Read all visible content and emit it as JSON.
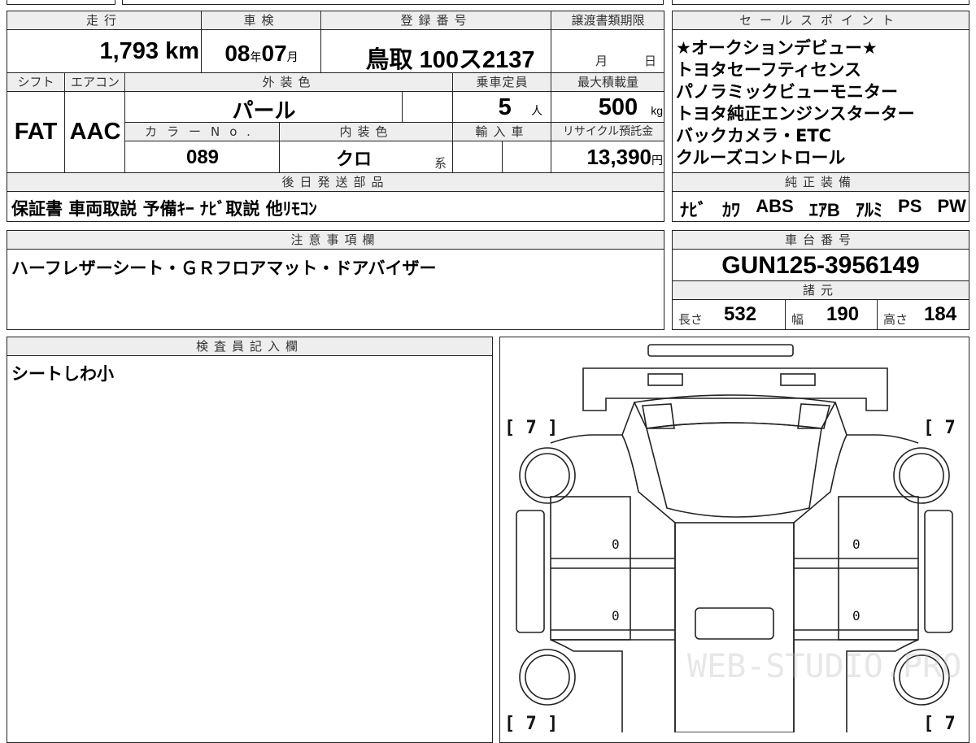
{
  "top_row": {
    "headers": {
      "mileage": "走行",
      "inspection": "車検",
      "registration": "登録番号",
      "transfer_deadline": "譲渡書類期限",
      "shift": "シフト",
      "aircon": "エアコン",
      "exterior_color": "外装色",
      "capacity": "乗車定員",
      "max_load": "最大積載量",
      "color_no": "カラーNo.",
      "interior_color": "内装色",
      "import": "輸入車",
      "recycle": "リサイクル預託金",
      "delivery_parts": "後日発送部品"
    },
    "mileage_value": "1,793",
    "mileage_unit": "km",
    "inspection_year": "08",
    "year_unit": "年",
    "inspection_month": "07",
    "month_unit": "月",
    "registration_value": "鳥取 100ス2137",
    "transfer_month_unit": "月",
    "transfer_day_unit": "日",
    "shift_value": "FAT",
    "aircon_value": "AAC",
    "exterior_color_value": "パール",
    "capacity_value": "5",
    "capacity_unit": "人",
    "max_load_value": "500",
    "max_load_unit": "kg",
    "color_no_value": "089",
    "interior_color_value": "クロ",
    "interior_suffix": "系",
    "recycle_value": "13,390",
    "recycle_unit": "円",
    "delivery_parts_value": "保証書 車両取説 予備ｷｰ ﾅﾋﾞ取説 他ﾘﾓｺﾝ"
  },
  "sales_points": {
    "header": "セールスポイント",
    "lines": [
      "★オークションデビュー★",
      "トヨタセーフティセンス",
      "パノラミックビューモニター",
      "トヨタ純正エンジンスターター",
      "バックカメラ・ETC",
      "クルーズコントロール"
    ]
  },
  "genuine_equipment": {
    "header": "純正装備",
    "items": [
      "ﾅﾋﾞ",
      "ｶﾜ",
      "ABS",
      "ｴｱB",
      "ｱﾙﾐ",
      "PS",
      "PW"
    ]
  },
  "notes": {
    "header": "注意事項欄",
    "text": "ハーフレザーシート・ＧＲフロアマット・ドアバイザー"
  },
  "chassis": {
    "header": "車台番号",
    "value": "GUN125-3956149"
  },
  "dimensions": {
    "header": "諸元",
    "length_label": "長さ",
    "length": "532",
    "width_label": "幅",
    "width": "190",
    "height_label": "高さ",
    "height": "184"
  },
  "inspector": {
    "header": "検査員記入欄",
    "text": "シートしわ小"
  },
  "diagram": {
    "tire_marks": [
      "[ 7 ]",
      "[ 7 ]",
      "[ 7 ]",
      "[ 7 ]"
    ],
    "damage_marks": [
      "0",
      "0",
      "0",
      "0"
    ],
    "watermark": "WEB-STUDIO.PRO"
  }
}
